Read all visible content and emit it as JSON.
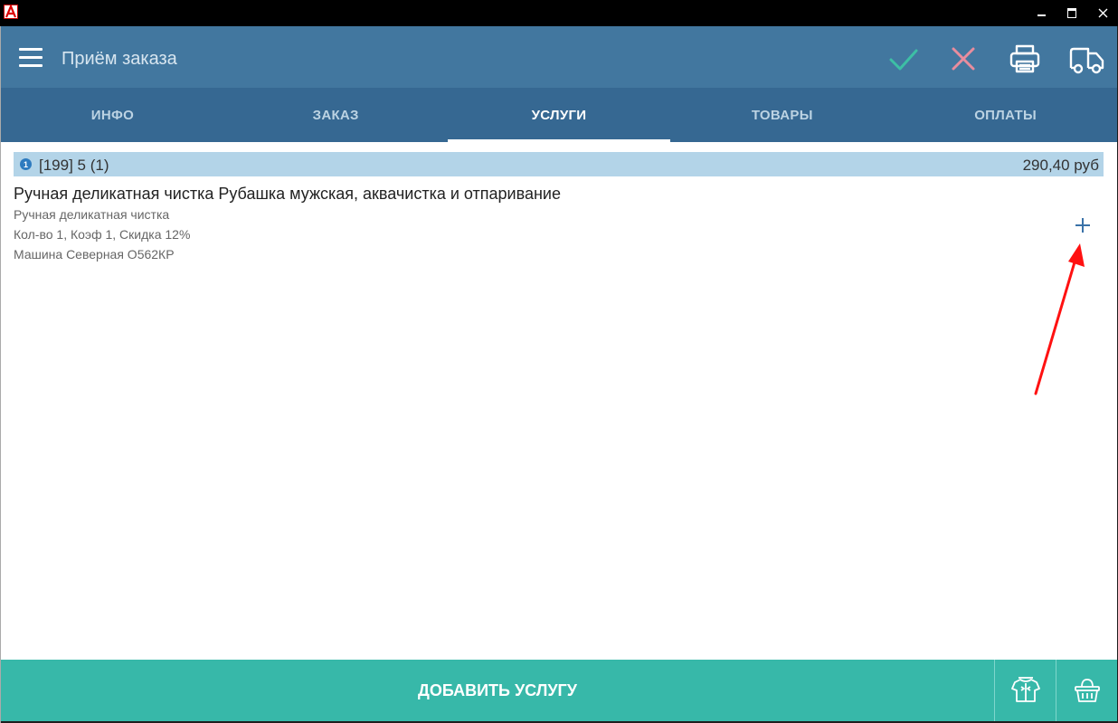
{
  "window": {
    "minimize_glyph": "—",
    "maximize_glyph": "▣",
    "close_glyph": "✕"
  },
  "appbar": {
    "title": "Приём заказа",
    "icons": [
      "menu-icon",
      "check-icon",
      "close-icon",
      "printer-icon",
      "truck-icon"
    ],
    "colors": {
      "check": "#3dbfa5",
      "close": "#e88d9e",
      "appbar": "#42779f",
      "tabs": "#366892"
    }
  },
  "tabs": [
    {
      "label": "ИНФО",
      "active": false
    },
    {
      "label": "ЗАКАЗ",
      "active": false
    },
    {
      "label": "УСЛУГИ",
      "active": true
    },
    {
      "label": "ТОВАРЫ",
      "active": false
    },
    {
      "label": "ОПЛАТЫ",
      "active": false
    }
  ],
  "service_item": {
    "badge": "1",
    "id_text": "[199] 5 (1)",
    "price": "290,40 руб",
    "name": "Ручная деликатная чистка Рубашка мужская, аквачистка и отпаривание",
    "lines": [
      "Ручная деликатная чистка",
      "Кол-во 1, Коэф 1, Скидка 12%",
      "Машина Северная О562КР"
    ]
  },
  "bottom": {
    "add_service_label": "ДОБАВИТЬ УСЛУГУ",
    "icons": [
      "clothes-icon",
      "basket-icon"
    ],
    "color": "#37b8a9"
  }
}
